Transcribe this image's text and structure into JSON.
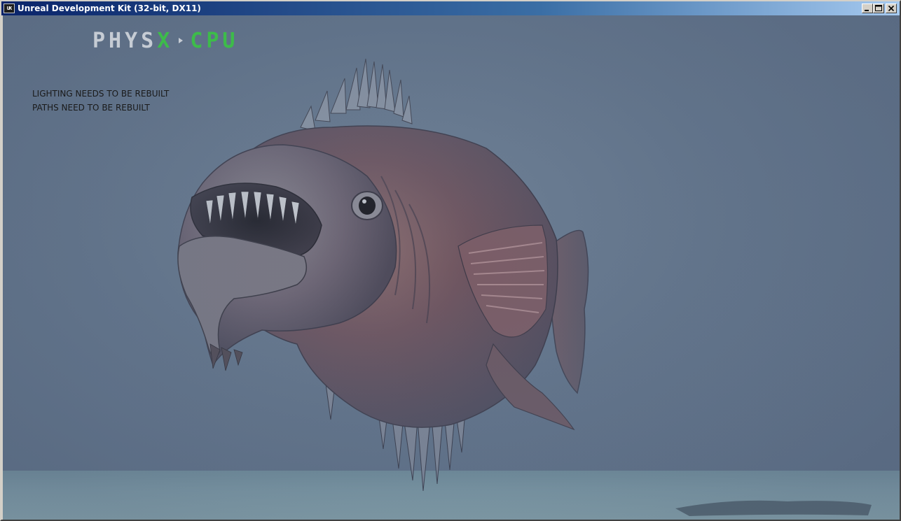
{
  "window": {
    "title": "Unreal Development Kit (32-bit, DX11)",
    "icon": "udk-app-icon",
    "controls": [
      "minimize-icon",
      "maximize-icon",
      "close-icon"
    ]
  },
  "overlay": {
    "physx_word_start": "PHYS",
    "physx_word_x": "X",
    "physx_mode": "CPU",
    "status_lines": [
      "LIGHTING NEEDS TO BE REBUILT",
      "PATHS NEED TO BE REBUILT"
    ]
  },
  "colors": {
    "titlebar": "#0a246a",
    "physx_green": "#3dbb4a",
    "fog": "#61738a"
  }
}
